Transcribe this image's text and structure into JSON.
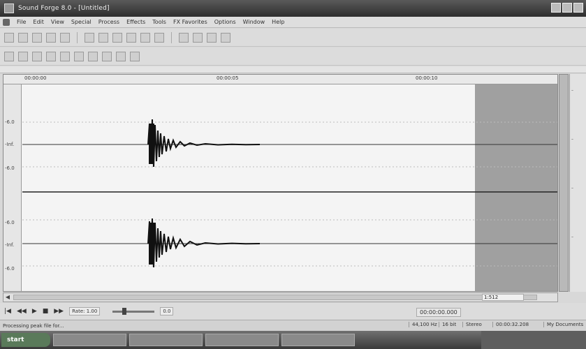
{
  "window": {
    "title": "Sound Forge 8.0 - [Untitled]"
  },
  "menu": {
    "items": [
      "File",
      "Edit",
      "View",
      "Special",
      "Process",
      "Effects",
      "Tools",
      "FX Favorites",
      "Options",
      "Window",
      "Help"
    ]
  },
  "editor": {
    "ruler_marks": [
      "00:00:00",
      "00:00:05",
      "00:00:10"
    ],
    "left_scale": [
      "-6.0",
      "-Inf.",
      "-6.0",
      "-6.0",
      "-Inf.",
      "-6.0"
    ],
    "zoom_ratio": "1:512"
  },
  "transport": {
    "rate_label": "Rate: 1.00",
    "slider_label": "0.0",
    "time_display": "00:00:00.000"
  },
  "status": {
    "text": "Processing peak file for...",
    "panels": [
      "44,100 Hz",
      "16 bit",
      "Stereo",
      "00:00:32.208",
      "My Documents"
    ]
  },
  "taskbar": {
    "start_label": "start"
  },
  "colors": {
    "waveform": "#1a1a1a",
    "selection": "#9c9c9c",
    "background": "#f4f4f4"
  }
}
